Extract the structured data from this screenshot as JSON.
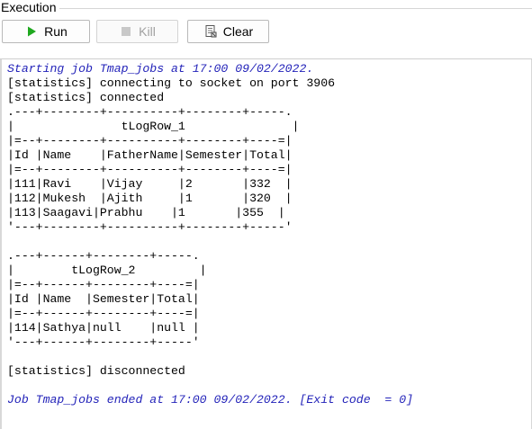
{
  "panel": {
    "title": "Execution"
  },
  "toolbar": {
    "run_label": "Run",
    "kill_label": "Kill",
    "clear_label": "Clear"
  },
  "icons": {
    "run": "play-icon",
    "kill": "stop-icon",
    "clear": "clear-console-icon"
  },
  "colors": {
    "info_text": "#2323b9",
    "run_icon": "#1fa81f"
  },
  "console": {
    "lines": [
      {
        "text": "Starting job Tmap_jobs at 17:00 09/02/2022.",
        "style": "info"
      },
      {
        "text": "[statistics] connecting to socket on port 3906",
        "style": "plain"
      },
      {
        "text": "[statistics] connected",
        "style": "plain"
      },
      {
        "text": ".---+--------+----------+--------+-----.",
        "style": "plain"
      },
      {
        "text": "|               tLogRow_1               |",
        "style": "plain"
      },
      {
        "text": "|=--+--------+----------+--------+----=|",
        "style": "plain"
      },
      {
        "text": "|Id |Name    |FatherName|Semester|Total|",
        "style": "plain"
      },
      {
        "text": "|=--+--------+----------+--------+----=|",
        "style": "plain"
      },
      {
        "text": "|111|Ravi    |Vijay     |2       |332  |",
        "style": "plain"
      },
      {
        "text": "|112|Mukesh  |Ajith     |1       |320  |",
        "style": "plain"
      },
      {
        "text": "|113|Saagavi|Prabhu    |1       |355  |",
        "style": "plain"
      },
      {
        "text": "'---+--------+----------+--------+-----'",
        "style": "plain"
      },
      {
        "text": "",
        "style": "plain"
      },
      {
        "text": ".---+------+--------+-----.",
        "style": "plain"
      },
      {
        "text": "|        tLogRow_2         |",
        "style": "plain"
      },
      {
        "text": "|=--+------+--------+----=|",
        "style": "plain"
      },
      {
        "text": "|Id |Name  |Semester|Total|",
        "style": "plain"
      },
      {
        "text": "|=--+------+--------+----=|",
        "style": "plain"
      },
      {
        "text": "|114|Sathya|null    |null |",
        "style": "plain"
      },
      {
        "text": "'---+------+--------+-----'",
        "style": "plain"
      },
      {
        "text": "",
        "style": "plain"
      },
      {
        "text": "[statistics] disconnected",
        "style": "plain"
      },
      {
        "text": "",
        "style": "plain"
      },
      {
        "text": "Job Tmap_jobs ended at 17:00 09/02/2022. [Exit code  = 0]",
        "style": "info"
      }
    ]
  }
}
